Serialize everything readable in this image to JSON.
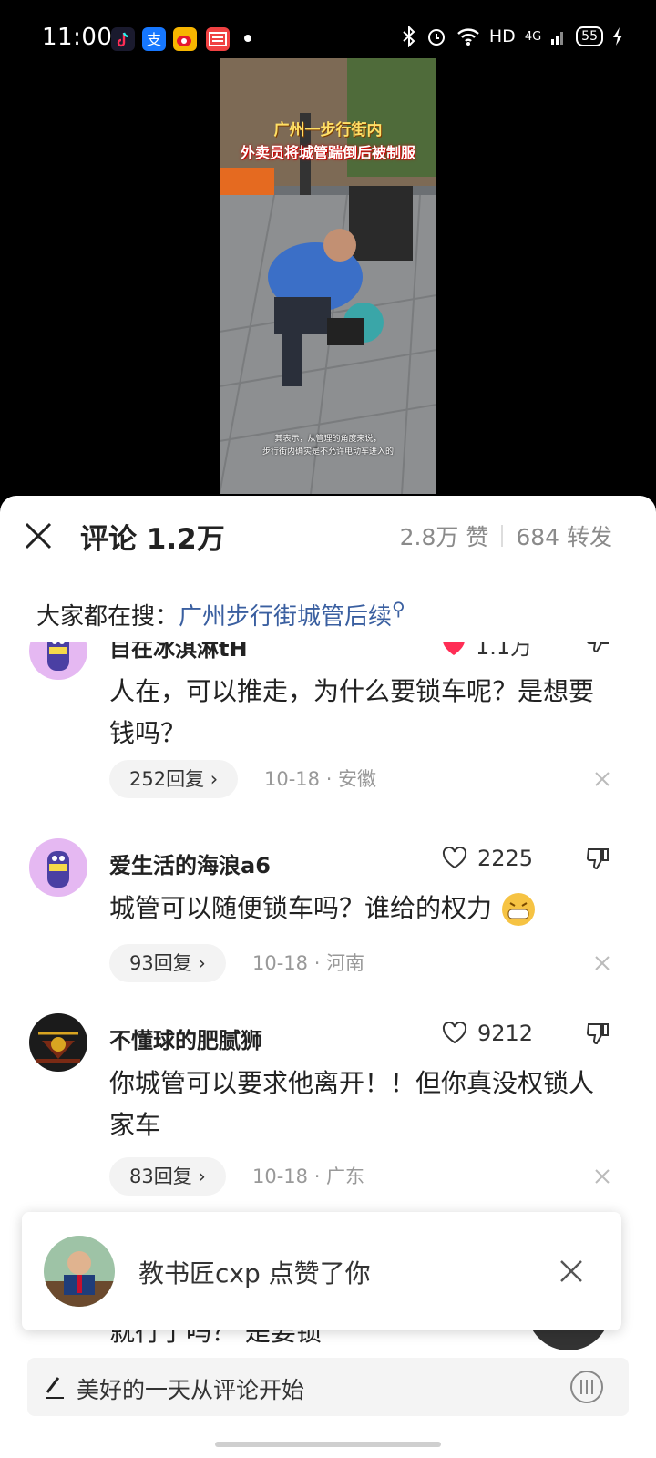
{
  "status_bar": {
    "time": "11:00",
    "network": "HD",
    "signal": "4G",
    "battery": "55"
  },
  "video": {
    "title_line1": "广州一步行街内",
    "title_line2": "外卖员将城管踹倒后被制服",
    "subtitle_line1": "其表示，从管理的角度来说，",
    "subtitle_line2": "步行街内确实是不允许电动车进入的"
  },
  "header": {
    "title": "评论 1.2万",
    "likes": "2.8万 赞",
    "reposts": "684 转发"
  },
  "trending": {
    "prefix": "大家都在搜：",
    "query": "广州步行街城管后续"
  },
  "comments": [
    {
      "username": "自在冰淇淋tH",
      "likes": "1.1万",
      "liked": true,
      "text": "人在，可以推走，为什么要锁车呢？是想要钱吗？",
      "replies": "252回复",
      "meta": "10-18 · 安徽"
    },
    {
      "username": "爱生活的海浪a6",
      "likes": "2225",
      "liked": false,
      "text": "城管可以随便锁车吗？谁给的权力",
      "replies": "93回复",
      "meta": "10-18 · 河南"
    },
    {
      "username": "不懂球的肥腻狮",
      "likes": "9212",
      "liked": false,
      "text": "你城管可以要求他离开！！但你真没权锁人家车",
      "replies": "83回复",
      "meta": "10-18 · 广东"
    }
  ],
  "toast": {
    "text": "教书匠cxp 点赞了你"
  },
  "partial_text": "就行了吗？  是要锁",
  "input": {
    "placeholder": "美好的一天从评论开始"
  },
  "colors": {
    "link": "#3a5fa0",
    "like_red": "#ff2d55",
    "sheet_bg": "#ffffff"
  }
}
